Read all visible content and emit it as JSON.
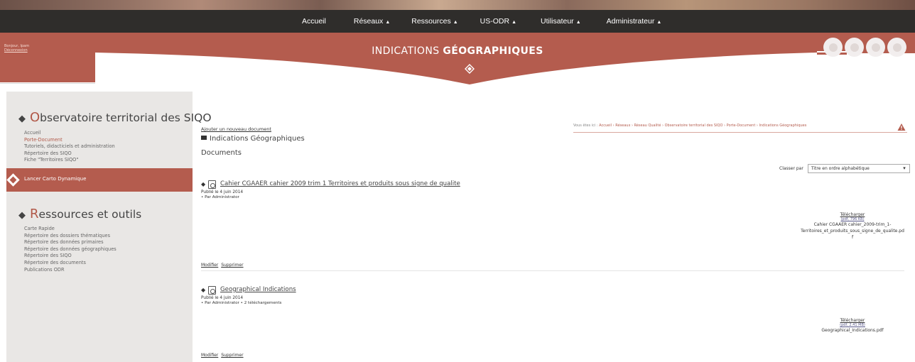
{
  "nav": {
    "items": [
      {
        "label": "Accueil",
        "arrow": ""
      },
      {
        "label": "Réseaux",
        "arrow": "▲"
      },
      {
        "label": "Ressources",
        "arrow": "▲"
      },
      {
        "label": "US-ODR",
        "arrow": "▲"
      },
      {
        "label": "Utilisateur",
        "arrow": "▲"
      },
      {
        "label": "Administrateur",
        "arrow": "▲"
      }
    ]
  },
  "header": {
    "greeting": "Bonjour, Ipam",
    "logout": "Déconnexion",
    "title_light": "INDICATIONS ",
    "title_bold": "GÉOGRAPHIQUES",
    "brand_color": "#b45c4e"
  },
  "sidebar": {
    "section1": {
      "first_letter": "O",
      "title_rest": "bservatoire territorial des SIQO",
      "items": [
        {
          "label": "Accueil",
          "active": false
        },
        {
          "label": "Porte-Document",
          "active": true
        },
        {
          "label": "Tutoriels, didacticiels et administration",
          "active": false
        },
        {
          "label": "Répertoire des SIQO",
          "active": false
        },
        {
          "label": "Fiche \"Territoires SIQO\"",
          "active": false
        }
      ]
    },
    "cta_label": "Lancer Carto Dynamique",
    "section2": {
      "first_letter": "R",
      "title_rest": "essources et outils",
      "items": [
        {
          "label": "Carte Rapide"
        },
        {
          "label": "Répertoire des dossiers thématiques"
        },
        {
          "label": "Répertoire des données primaires"
        },
        {
          "label": "Répertoire des données géographiques"
        },
        {
          "label": "Répertoire des SIQO"
        },
        {
          "label": "Répertoire des documents"
        },
        {
          "label": "Publications ODR"
        }
      ]
    }
  },
  "breadcrumb": {
    "prefix": "Vous êtes ici :",
    "items": [
      "Accueil",
      "Réseaux",
      "Réseau Qualité",
      "Observatoire territorial des SIQO",
      "Porte-Document",
      "Indications Géographiques"
    ]
  },
  "main": {
    "add_document": "Ajouter un nouveau document",
    "folder_title": "Indications Géographiques",
    "docs_heading": "Documents",
    "sort_label": "Classer par",
    "sort_value": "Titre en ordre alphabétique",
    "documents": [
      {
        "title": "Cahier CGAAER cahier 2009 trim 1 Territoires et produits sous signe de qualite",
        "published": "Publié le 4 juin 2014",
        "meta": "• Par Administrator",
        "download": "Télécharger",
        "size": "(pdf, 796 KB)",
        "filename_l1": "Cahier CGAAER cahier_2009-trim_1-",
        "filename_l2": "Territoires_et_produits_sous_signe_de_qualite.pd",
        "filename_l3": "f",
        "edit": "Modifier",
        "delete": "Supprimer"
      },
      {
        "title": "Geographical Indications",
        "published": "Publié le 4 juin 2014",
        "meta": "• Par Administrator • 2 téléchargements",
        "download": "Télécharger",
        "size": "(pdf, 2.41 MB)",
        "filename_l1": "Geographical_Indications.pdf",
        "edit": "Modifier",
        "delete": "Supprimer"
      }
    ]
  }
}
